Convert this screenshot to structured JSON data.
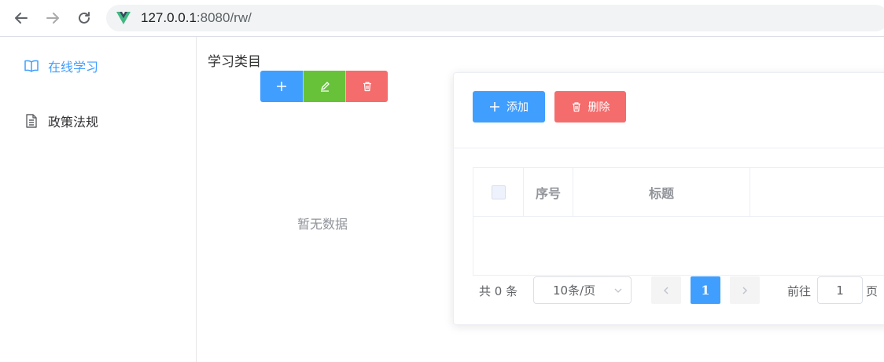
{
  "browser": {
    "url_host": "127.0.0.1",
    "url_rest": ":8080/rw/",
    "back_icon": "arrow-left-icon",
    "forward_icon": "arrow-right-icon",
    "reload_icon": "reload-icon",
    "favicon": "vue-logo-icon"
  },
  "sidebar": {
    "items": [
      {
        "label": "在线学习",
        "icon": "book-icon",
        "active": true
      },
      {
        "label": "政策法规",
        "icon": "document-icon",
        "active": false
      }
    ]
  },
  "category": {
    "title": "学习类目",
    "empty_text": "暂无数据"
  },
  "toolbar": {
    "add_label": "添加",
    "delete_label": "删除"
  },
  "table": {
    "columns": [
      "序号",
      "标题"
    ]
  },
  "pagination": {
    "total_text": "共 0 条",
    "page_size": "10条/页",
    "current_page": "1",
    "goto_label": "前往",
    "goto_value": "1",
    "page_suffix": "页"
  },
  "colors": {
    "primary": "#409eff",
    "success": "#67c23a",
    "danger": "#f56c6c"
  }
}
